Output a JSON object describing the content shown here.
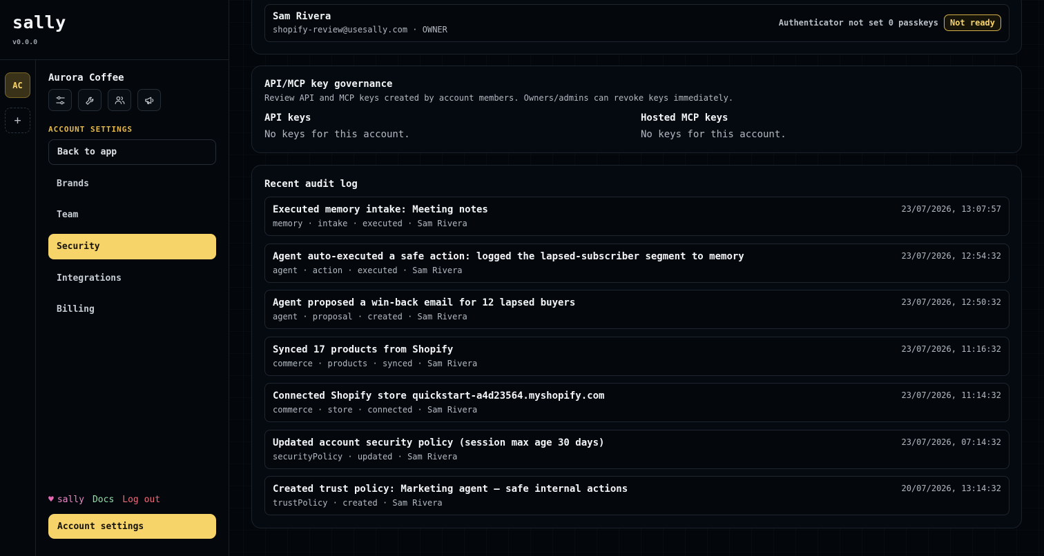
{
  "brand": {
    "name": "sally",
    "version": "v0.0.0"
  },
  "rail": {
    "workspace_initials": "AC",
    "add_symbol": "+"
  },
  "sidebar": {
    "workspace_name": "Aurora Coffee",
    "tool_icons": [
      "sliders-icon",
      "wrench-icon",
      "users-icon",
      "megaphone-icon"
    ],
    "section_label": "ACCOUNT SETTINGS",
    "back_label": "Back to app",
    "items": [
      {
        "label": "Brands",
        "active": false
      },
      {
        "label": "Team",
        "active": false
      },
      {
        "label": "Security",
        "active": true
      },
      {
        "label": "Integrations",
        "active": false
      },
      {
        "label": "Billing",
        "active": false
      }
    ],
    "footer": {
      "heart": "♥",
      "sally": "sally",
      "docs": "Docs",
      "logout": "Log out"
    },
    "account_settings": "Account settings"
  },
  "member": {
    "name": "Sam Rivera",
    "email_role": "shopify-review@usesally.com · OWNER",
    "status_text": "Authenticator not set 0 passkeys",
    "badge": "Not ready"
  },
  "keys": {
    "title": "API/MCP key governance",
    "description": "Review API and MCP keys created by account members. Owners/admins can revoke keys immediately.",
    "api_title": "API keys",
    "api_empty": "No keys for this account.",
    "mcp_title": "Hosted MCP keys",
    "mcp_empty": "No keys for this account."
  },
  "audit": {
    "title": "Recent audit log",
    "entries": [
      {
        "title": "Executed memory intake: Meeting notes",
        "meta": "memory · intake · executed · Sam Rivera",
        "time": "23/07/2026, 13:07:57"
      },
      {
        "title": "Agent auto-executed a safe action: logged the lapsed-subscriber segment to memory",
        "meta": "agent · action · executed · Sam Rivera",
        "time": "23/07/2026, 12:54:32"
      },
      {
        "title": "Agent proposed a win-back email for 12 lapsed buyers",
        "meta": "agent · proposal · created · Sam Rivera",
        "time": "23/07/2026, 12:50:32"
      },
      {
        "title": "Synced 17 products from Shopify",
        "meta": "commerce · products · synced · Sam Rivera",
        "time": "23/07/2026, 11:16:32"
      },
      {
        "title": "Connected Shopify store quickstart-a4d23564.myshopify.com",
        "meta": "commerce · store · connected · Sam Rivera",
        "time": "23/07/2026, 11:14:32"
      },
      {
        "title": "Updated account security policy (session max age 30 days)",
        "meta": "securityPolicy · updated · Sam Rivera",
        "time": "23/07/2026, 07:14:32"
      },
      {
        "title": "Created trust policy: Marketing agent – safe internal actions",
        "meta": "trustPolicy · created · Sam Rivera",
        "time": "20/07/2026, 13:14:32"
      }
    ]
  }
}
